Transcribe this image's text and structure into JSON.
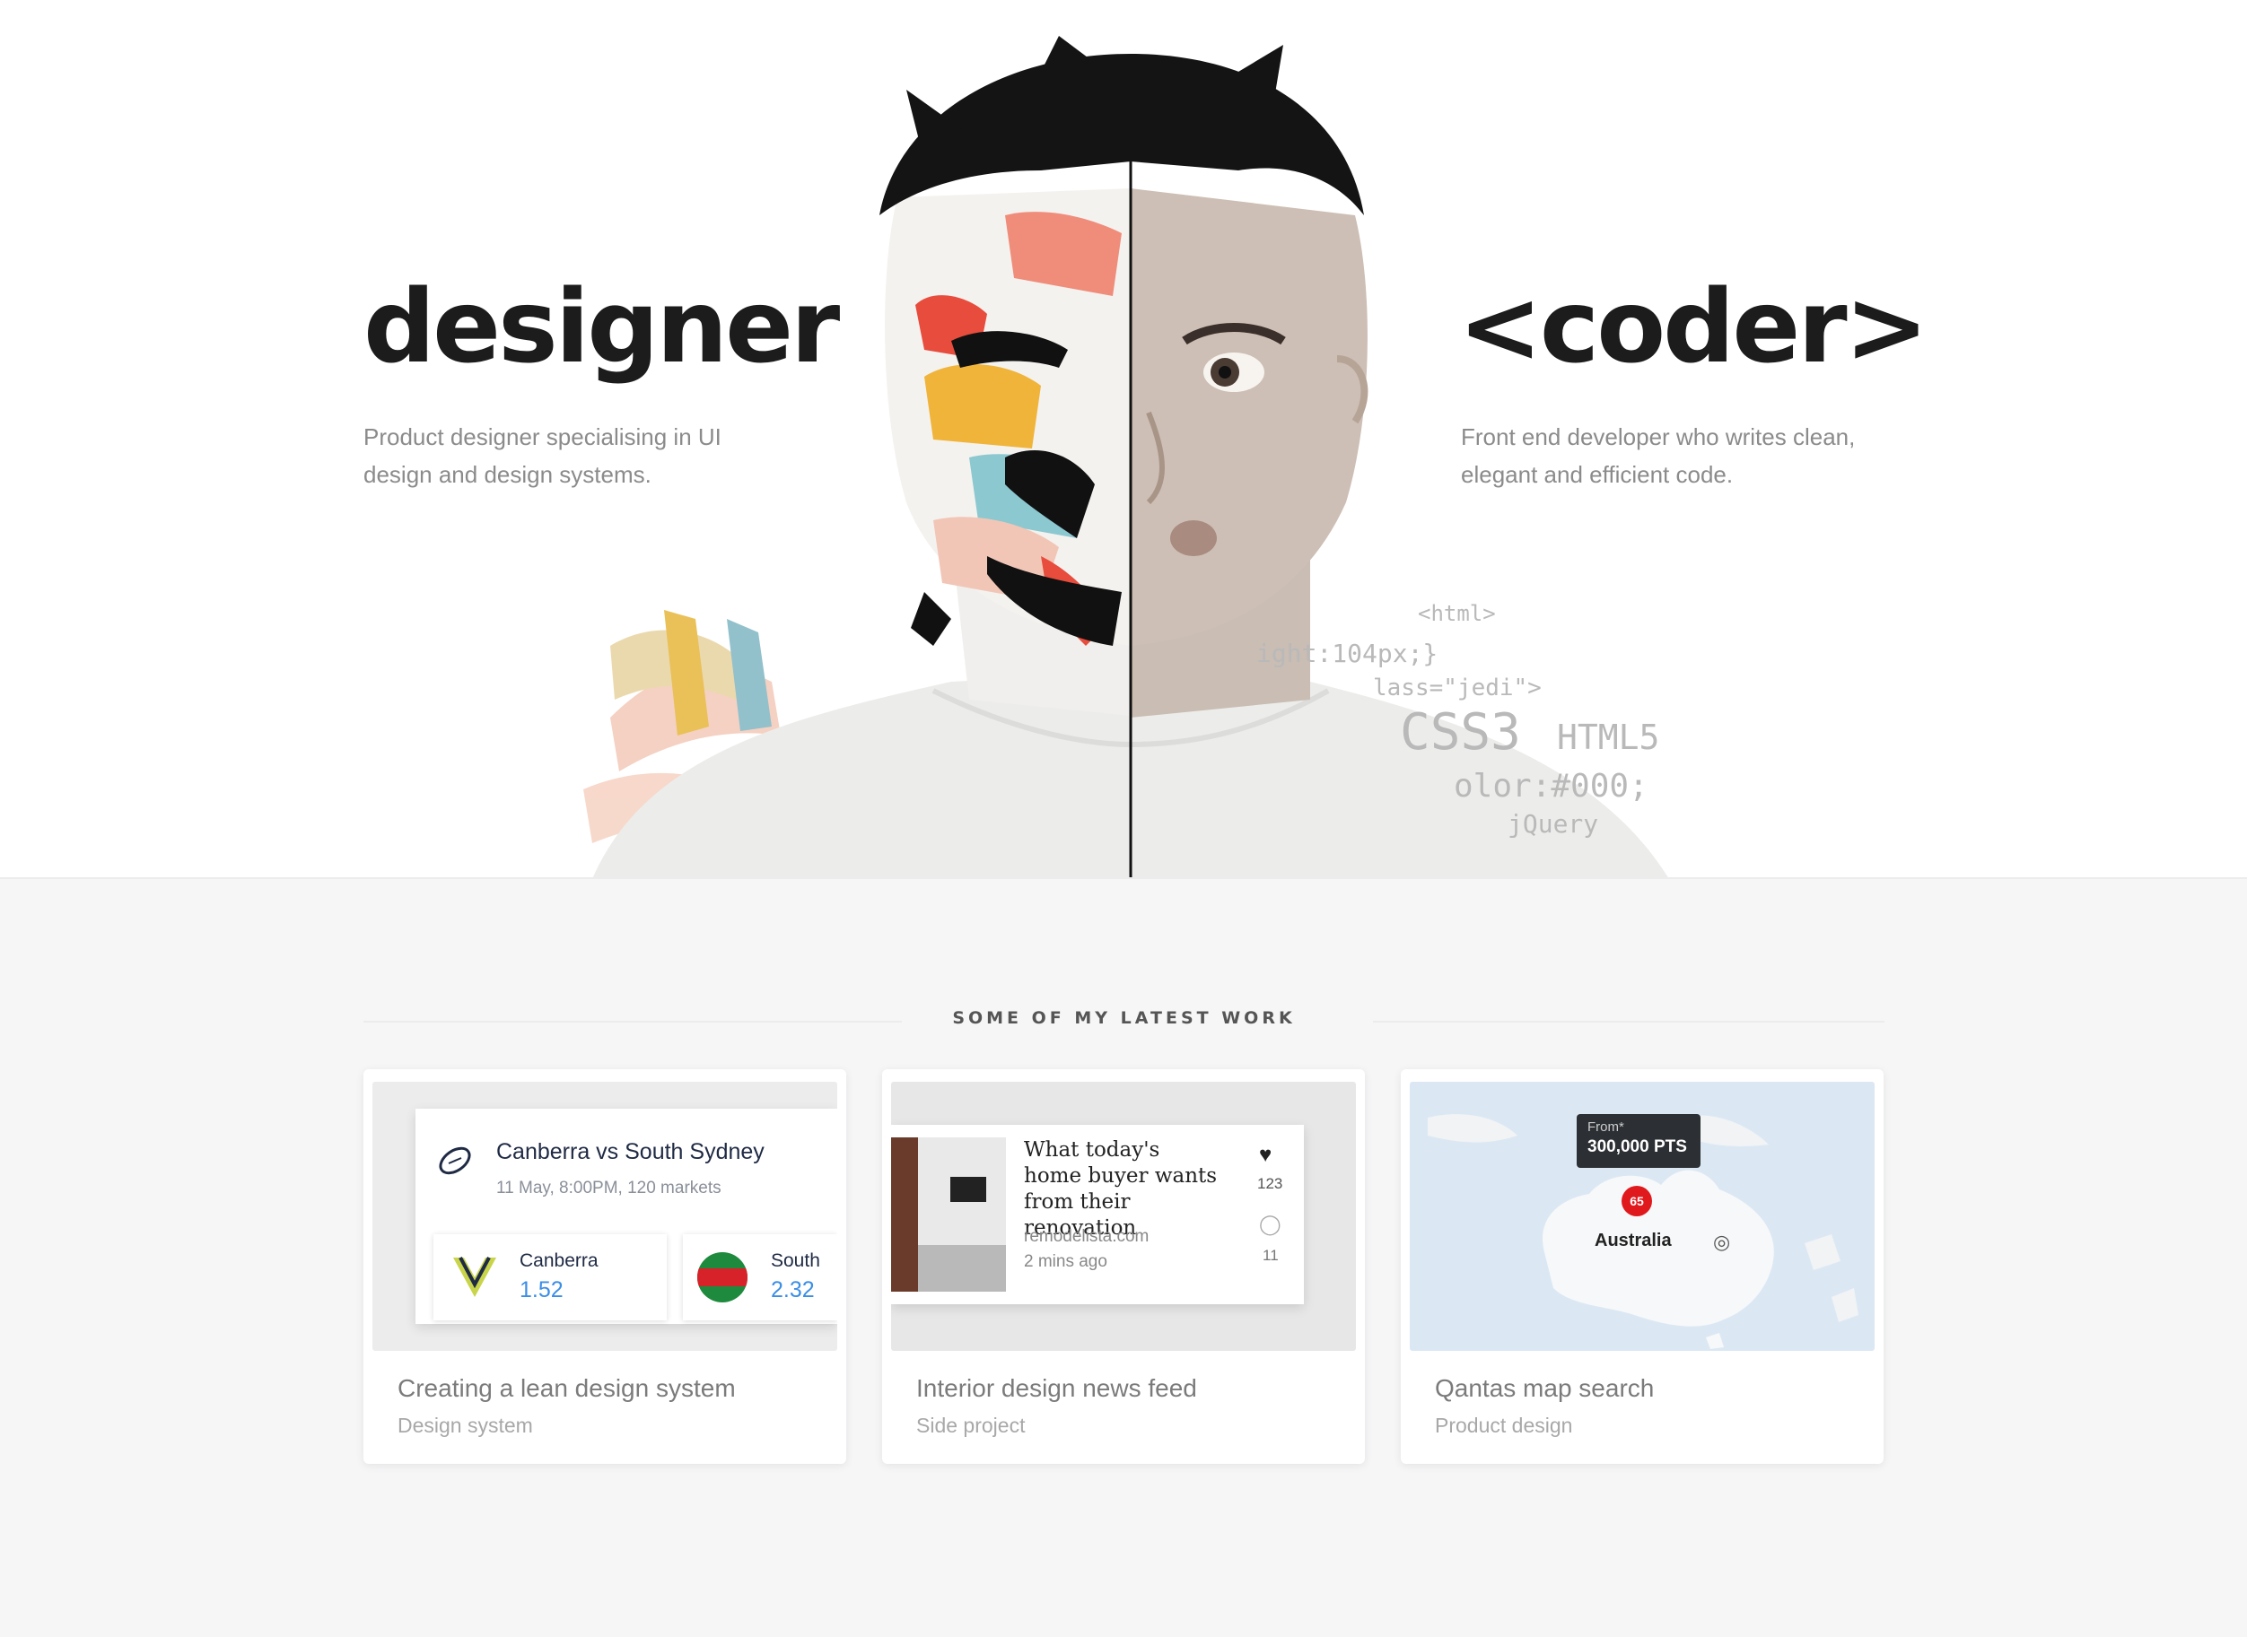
{
  "hero": {
    "designer_heading": "designer",
    "designer_description": "Product designer specialising in UI design and design systems.",
    "coder_heading": "<coder>",
    "coder_description": "Front end developer who writes clean, elegant and efficient code.",
    "code_snippets": [
      "<html>",
      "ight:104px;}",
      "lass=\"jedi\">",
      "CSS3",
      "HTML5",
      "olor:#000;",
      "jQuery"
    ]
  },
  "work": {
    "section_title": "SOME OF MY LATEST WORK",
    "cards": [
      {
        "title": "Creating a lean design system",
        "subtitle": "Design system",
        "thumb": {
          "match_title": "Canberra vs South Sydney",
          "match_meta": "11 May, 8:00PM, 120 markets",
          "team1_name": "Canberra",
          "team1_odds": "1.52",
          "team2_name": "South",
          "team2_odds": "2.32"
        }
      },
      {
        "title": "Interior design news feed",
        "subtitle": "Side project",
        "thumb": {
          "headline": "What today's home buyer wants from their renovation",
          "source": "remodelista.com",
          "time": "2 mins ago",
          "likes": "123",
          "comments": "11"
        }
      },
      {
        "title": "Qantas map search",
        "subtitle": "Product design",
        "thumb": {
          "tooltip_from": "From*",
          "tooltip_points": "300,000 PTS",
          "pin_label": "65",
          "country": "Australia"
        }
      }
    ]
  },
  "colors": {
    "background": "#f6f6f7",
    "hero_bg": "#ffffff",
    "heading": "#1c1c1c",
    "muted_text": "#8b8b8b",
    "odds_blue": "#3a8ee6",
    "pin_red": "#e0191d",
    "map_blue": "#dbe8f4"
  },
  "icons": {
    "rugby_ball": "rugby-ball-icon",
    "heart": "heart-icon",
    "comment": "comment-icon",
    "location_target": "target-icon"
  }
}
